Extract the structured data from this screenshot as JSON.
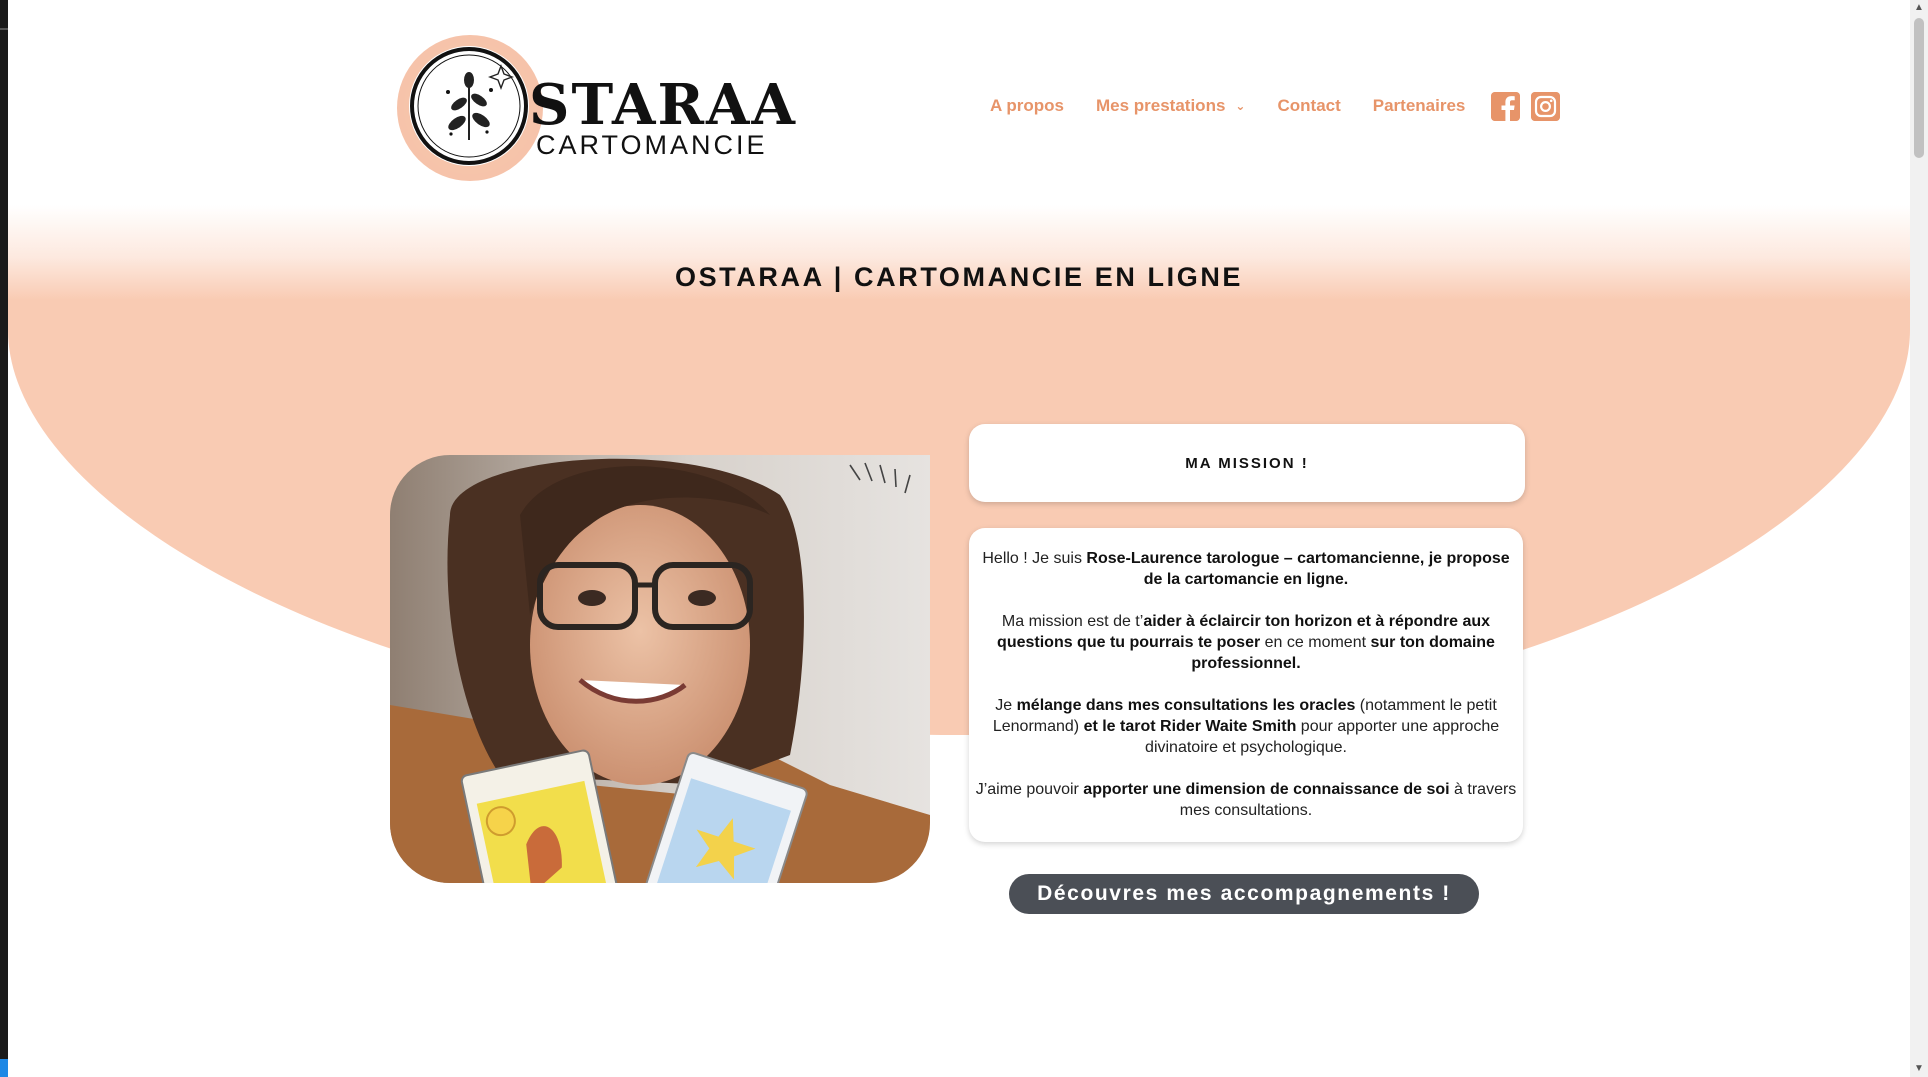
{
  "header": {
    "logo_word": "STARAA",
    "logo_sub": "CARTOMANCIE",
    "nav": [
      {
        "label": "A propos"
      },
      {
        "label": "Mes prestations",
        "has_dropdown": true
      },
      {
        "label": "Contact"
      },
      {
        "label": "Partenaires"
      }
    ],
    "social": [
      "facebook-icon",
      "instagram-icon"
    ]
  },
  "hero": {
    "title": "OSTARAA | CARTOMANCIE EN LIGNE"
  },
  "mission": {
    "heading": "MA MISSION !",
    "paragraphs": [
      [
        {
          "t": "Hello ! Je suis ",
          "b": false
        },
        {
          "t": "Rose-Laurence tarologue – cartomancienne, je propose de la cartomancie en ligne.",
          "b": true
        }
      ],
      [
        {
          "t": "Ma mission est de t’",
          "b": false
        },
        {
          "t": "aider à éclaircir ton horizon et à répondre aux questions que tu pourrais te poser",
          "b": true
        },
        {
          "t": " en ce moment ",
          "b": false
        },
        {
          "t": "sur ton domaine professionnel.",
          "b": true
        }
      ],
      [
        {
          "t": "Je ",
          "b": false
        },
        {
          "t": "mélange dans mes consultations les oracles",
          "b": true
        },
        {
          "t": " (notamment le petit Lenormand) ",
          "b": false
        },
        {
          "t": "et le tarot Rider Waite Smith",
          "b": true
        },
        {
          "t": " pour apporter une approche divinatoire et psychologique.",
          "b": false
        }
      ],
      [
        {
          "t": "J’aime pouvoir ",
          "b": false
        },
        {
          "t": "apporter une dimension de connaissance de soi",
          "b": true
        },
        {
          "t": " à travers mes consultations.",
          "b": false
        }
      ]
    ]
  },
  "cta": {
    "label": "Découvres mes accompagnements !"
  },
  "colors": {
    "peach": "#f9cbb3",
    "accent": "#e79469",
    "button": "#4b4f56"
  }
}
